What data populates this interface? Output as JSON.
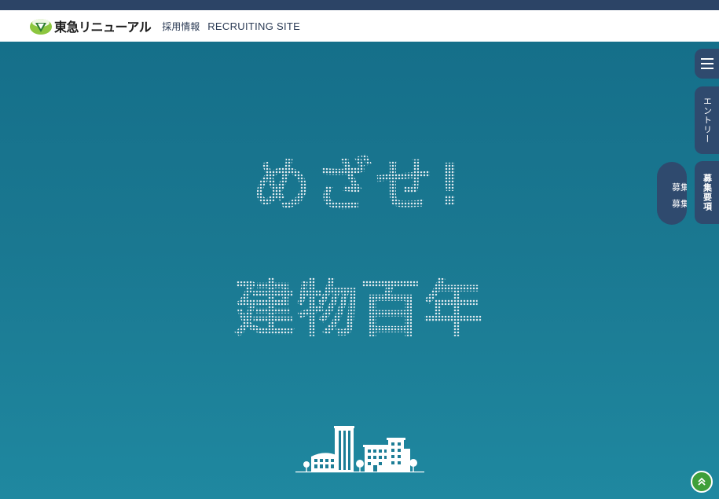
{
  "header": {
    "logo_text": "東急リニューアル",
    "site_label": "採用情報",
    "site_label_en": "RECRUITING SITE"
  },
  "hero": {
    "line1": "めざせ!",
    "line2": "建物百年"
  },
  "side_nav": {
    "menu_icon": "hamburger-icon",
    "entry_label": "エントリー",
    "requirements_label": "募集要項",
    "ghost_line1": "募集要",
    "ghost_line2": "募集要"
  },
  "back_to_top_icon": "double-chevron-up-icon",
  "colors": {
    "top_strip": "#2c4466",
    "hero_bg": "#1a7790",
    "side_button": "#2f4a6e",
    "to_top": "#3f9f3a"
  }
}
